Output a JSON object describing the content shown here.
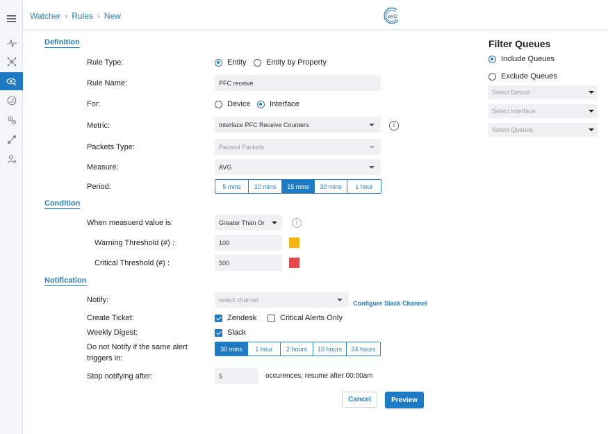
{
  "header": {
    "breadcrumb": [
      "Watcher",
      "Rules",
      "New"
    ],
    "logo_text": "aviz"
  },
  "sidebar": {
    "icons": [
      "pulse-icon",
      "network-icon",
      "watcher-eye-icon",
      "dashboard-gauge-icon",
      "settings-gears-icon",
      "connection-icon",
      "user-icon"
    ],
    "active_index": 2
  },
  "definition": {
    "title": "Definition",
    "rule_type": {
      "label": "Rule Type:",
      "options": [
        "Entity",
        "Entity by Property"
      ],
      "selected": 0
    },
    "rule_name": {
      "label": "Rule Name:",
      "value": "PFC receive"
    },
    "for": {
      "label": "For:",
      "options": [
        "Device",
        "Interface"
      ],
      "selected": 1
    },
    "metric": {
      "label": "Metric:",
      "value": "Interface PFC Receive Counters"
    },
    "packets_type": {
      "label": "Packets Type:",
      "value": "Paused Packets"
    },
    "measure": {
      "label": "Measure:",
      "value": "AVG"
    },
    "period": {
      "label": "Period:",
      "options": [
        "5 mins",
        "10 mins",
        "15 mins",
        "30 mins",
        "1 hour"
      ],
      "selected": 2
    }
  },
  "condition": {
    "title": "Condition",
    "when": {
      "label": "When measuerd value is:",
      "value": "Greater Than Or"
    },
    "warning": {
      "label": "Warning Threshold (#) :",
      "value": "100",
      "color": "#f5b40f"
    },
    "critical": {
      "label": "Critical Threshold (#) :",
      "value": "500",
      "color": "#e8494b"
    }
  },
  "notification": {
    "title": "Notification",
    "notify": {
      "label": "Notify:",
      "placeholder": "select channel",
      "link": "Configure Slack Channel"
    },
    "create_ticket": {
      "label": "Create Ticket:",
      "options": [
        {
          "label": "Zendesk",
          "checked": true
        },
        {
          "label": "Critical Alerts Only",
          "checked": false
        }
      ]
    },
    "weekly_digest": {
      "label": "Weekly Digest:",
      "option": "Slack",
      "checked": true
    },
    "do_not_notify": {
      "label_line1": "Do not Notify if the same alert",
      "label_line2": "triggers in:",
      "options": [
        "30 mins",
        "1 hour",
        "2 hours",
        "10 hours",
        "24 hours"
      ],
      "selected": 0
    },
    "stop_notifying": {
      "label": "Stop notifying after:",
      "value": "5",
      "suffix": "occurences, resume after 00:00am"
    }
  },
  "actions": {
    "cancel": "Cancel",
    "preview": "Preview"
  },
  "filter_queues": {
    "title": "Filter Queues",
    "options": [
      "Include Queues",
      "Exclude Queues"
    ],
    "selected": 0,
    "selects": [
      "Select Device",
      "Select Interface",
      "Select Queues"
    ]
  },
  "colors": {
    "accent": "#1f7ac4",
    "link": "#2c7fc0"
  }
}
